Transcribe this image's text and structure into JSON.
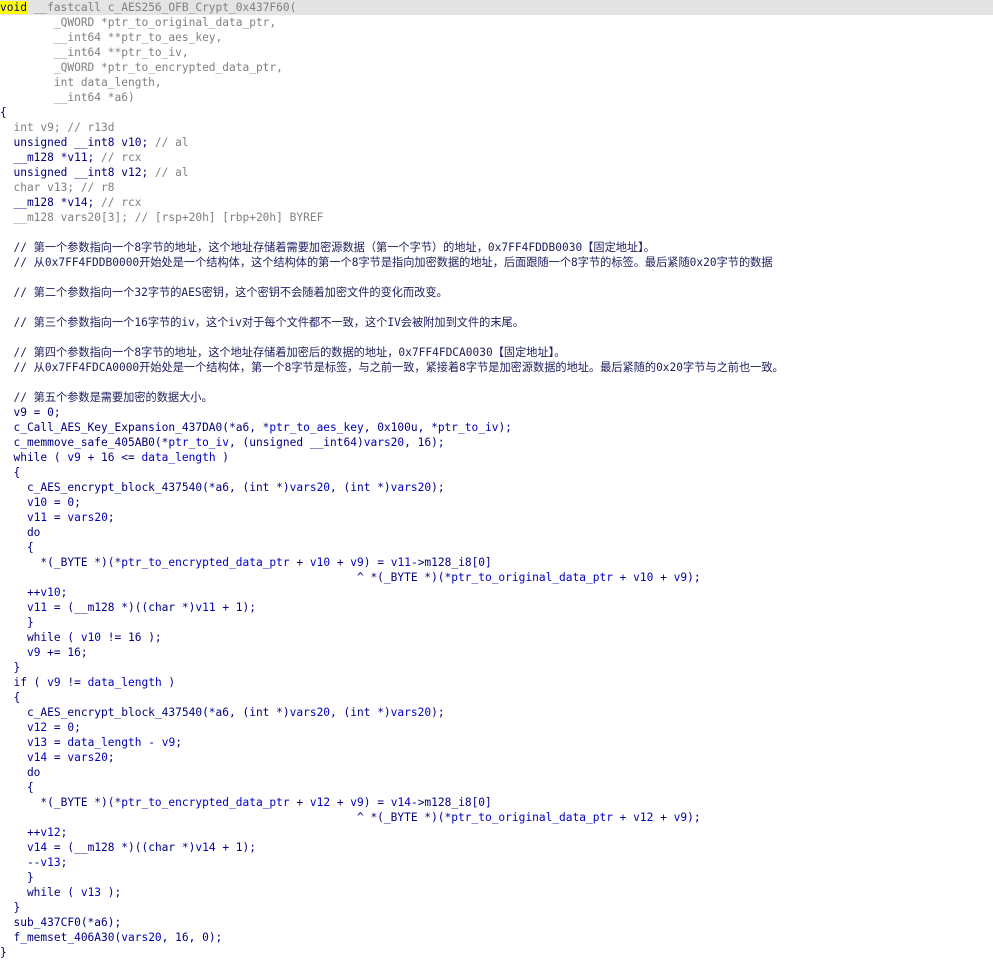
{
  "colors": {
    "background": "#ffffff",
    "highlight_line": "#e4e4e4",
    "keyword_highlight": "#ffff00",
    "text": "#000080",
    "variable": "#0000c0",
    "type_gray": "#808080",
    "comment": "#408080"
  },
  "code": {
    "lines": [
      [
        {
          "t": "void",
          "c": "kw-hl"
        },
        {
          "t": " __fastcall c_AES256_OFB_Crypt_0x437F60(",
          "c": "type"
        }
      ],
      [
        {
          "t": "        _QWORD *ptr_to_original_data_ptr,",
          "c": "type"
        }
      ],
      [
        {
          "t": "        __int64 **ptr_to_aes_key,",
          "c": "type"
        }
      ],
      [
        {
          "t": "        __int64 **ptr_to_iv,",
          "c": "type"
        }
      ],
      [
        {
          "t": "        _QWORD *ptr_to_encrypted_data_ptr,",
          "c": "type"
        }
      ],
      [
        {
          "t": "        int data_length,",
          "c": "type"
        }
      ],
      [
        {
          "t": "        __int64 *a6)",
          "c": "type"
        }
      ],
      [
        {
          "t": "{",
          "c": "plain"
        }
      ],
      [
        {
          "t": "  int v9; // r13d",
          "c": "type"
        }
      ],
      [
        {
          "t": "  unsigned __int8 v10; ",
          "c": "plain"
        },
        {
          "t": "// al",
          "c": "type"
        }
      ],
      [
        {
          "t": "  __m128 *v11; ",
          "c": "plain"
        },
        {
          "t": "// rcx",
          "c": "type"
        }
      ],
      [
        {
          "t": "  unsigned __int8 v12; ",
          "c": "plain"
        },
        {
          "t": "// al",
          "c": "type"
        }
      ],
      [
        {
          "t": "  char v13; // r8",
          "c": "type"
        }
      ],
      [
        {
          "t": "  __m128 *v14; ",
          "c": "plain"
        },
        {
          "t": "// rcx",
          "c": "type"
        }
      ],
      [
        {
          "t": "  __m128 vars20[3]; // [rsp+20h] [rbp+20h] BYREF",
          "c": "type"
        }
      ],
      [
        {
          "t": "",
          "c": "plain"
        }
      ],
      [
        {
          "t": "  // 第一个参数指向一个8字节的地址，这个地址存储着需要加密源数据（第一个字节）的地址，0x7FF4FDDB0030【固定地址】。",
          "c": "cmt-cn"
        }
      ],
      [
        {
          "t": "  // 从0x7FF4FDDB0000开始处是一个结构体，这个结构体的第一个8字节是指向加密数据的地址，后面跟随一个8字节的标签。最后紧随0x20字节的数据",
          "c": "cmt-cn"
        }
      ],
      [
        {
          "t": "",
          "c": "plain"
        }
      ],
      [
        {
          "t": "  // 第二个参数指向一个32字节的AES密钥，这个密钥不会随着加密文件的变化而改变。",
          "c": "cmt-cn"
        }
      ],
      [
        {
          "t": "",
          "c": "plain"
        }
      ],
      [
        {
          "t": "  // 第三个参数指向一个16字节的iv，这个iv对于每个文件都不一致，这个IV会被附加到文件的末尾。",
          "c": "cmt-cn"
        }
      ],
      [
        {
          "t": "",
          "c": "plain"
        }
      ],
      [
        {
          "t": "  // 第四个参数指向一个8字节的地址，这个地址存储着加密后的数据的地址，0x7FF4FDCA0030【固定地址】。",
          "c": "cmt-cn"
        }
      ],
      [
        {
          "t": "  // 从0x7FF4FDCA0000开始处是一个结构体，第一个8字节是标签，与之前一致，紧接着8字节是加密源数据的地址。最后紧随的0x20字节与之前也一致。",
          "c": "cmt-cn"
        }
      ],
      [
        {
          "t": "",
          "c": "plain"
        }
      ],
      [
        {
          "t": "  // 第五个参数是需要加密的数据大小。",
          "c": "cmt-cn"
        }
      ],
      [
        {
          "t": "  v9 = 0;",
          "c": "plain"
        }
      ],
      [
        {
          "t": "  c_Call_AES_Key_Expansion_437DA0(*a6, *",
          "c": "plain"
        },
        {
          "t": "ptr_to_aes_key",
          "c": "var"
        },
        {
          "t": ", 0x100u, *",
          "c": "plain"
        },
        {
          "t": "ptr_to_iv",
          "c": "var"
        },
        {
          "t": ");",
          "c": "plain"
        }
      ],
      [
        {
          "t": "  c_memmove_safe_405AB0(*",
          "c": "plain"
        },
        {
          "t": "ptr_to_iv",
          "c": "var"
        },
        {
          "t": ", (unsigned __int64)",
          "c": "plain"
        },
        {
          "t": "vars20",
          "c": "var"
        },
        {
          "t": ", 16);",
          "c": "plain"
        }
      ],
      [
        {
          "t": "  while ( ",
          "c": "plain"
        },
        {
          "t": "v9",
          "c": "var"
        },
        {
          "t": " + 16 <= ",
          "c": "plain"
        },
        {
          "t": "data_length",
          "c": "var"
        },
        {
          "t": " )",
          "c": "plain"
        }
      ],
      [
        {
          "t": "  {",
          "c": "plain"
        }
      ],
      [
        {
          "t": "    c_AES_encrypt_block_437540(*a6, (int *)",
          "c": "plain"
        },
        {
          "t": "vars20",
          "c": "var"
        },
        {
          "t": ", (int *)",
          "c": "plain"
        },
        {
          "t": "vars20",
          "c": "var"
        },
        {
          "t": ");",
          "c": "plain"
        }
      ],
      [
        {
          "t": "    ",
          "c": "plain"
        },
        {
          "t": "v10",
          "c": "var"
        },
        {
          "t": " = 0;",
          "c": "plain"
        }
      ],
      [
        {
          "t": "    ",
          "c": "plain"
        },
        {
          "t": "v11",
          "c": "var"
        },
        {
          "t": " = ",
          "c": "plain"
        },
        {
          "t": "vars20",
          "c": "var"
        },
        {
          "t": ";",
          "c": "plain"
        }
      ],
      [
        {
          "t": "    do",
          "c": "plain"
        }
      ],
      [
        {
          "t": "    {",
          "c": "plain"
        }
      ],
      [
        {
          "t": "      *(_BYTE *)(*",
          "c": "plain"
        },
        {
          "t": "ptr_to_encrypted_data_ptr",
          "c": "var"
        },
        {
          "t": " + ",
          "c": "plain"
        },
        {
          "t": "v10",
          "c": "var"
        },
        {
          "t": " + ",
          "c": "plain"
        },
        {
          "t": "v9",
          "c": "var"
        },
        {
          "t": ") = ",
          "c": "plain"
        },
        {
          "t": "v11",
          "c": "var"
        },
        {
          "t": "->m128_i8[0]",
          "c": "plain"
        }
      ],
      [
        {
          "t": "                                                     ^ *(_BYTE *)(*",
          "c": "plain"
        },
        {
          "t": "ptr_to_original_data_ptr",
          "c": "var"
        },
        {
          "t": " + ",
          "c": "plain"
        },
        {
          "t": "v10",
          "c": "var"
        },
        {
          "t": " + ",
          "c": "plain"
        },
        {
          "t": "v9",
          "c": "var"
        },
        {
          "t": ");",
          "c": "plain"
        }
      ],
      [
        {
          "t": "    ++",
          "c": "plain"
        },
        {
          "t": "v10",
          "c": "var"
        },
        {
          "t": ";",
          "c": "plain"
        }
      ],
      [
        {
          "t": "    ",
          "c": "plain"
        },
        {
          "t": "v11",
          "c": "var"
        },
        {
          "t": " = (__m128 *)((char *)",
          "c": "plain"
        },
        {
          "t": "v11",
          "c": "var"
        },
        {
          "t": " + 1);",
          "c": "plain"
        }
      ],
      [
        {
          "t": "    }",
          "c": "plain"
        }
      ],
      [
        {
          "t": "    while ( ",
          "c": "plain"
        },
        {
          "t": "v10",
          "c": "var"
        },
        {
          "t": " != 16 );",
          "c": "plain"
        }
      ],
      [
        {
          "t": "    ",
          "c": "plain"
        },
        {
          "t": "v9",
          "c": "var"
        },
        {
          "t": " += 16;",
          "c": "plain"
        }
      ],
      [
        {
          "t": "  }",
          "c": "plain"
        }
      ],
      [
        {
          "t": "  if ( ",
          "c": "plain"
        },
        {
          "t": "v9",
          "c": "var"
        },
        {
          "t": " != ",
          "c": "plain"
        },
        {
          "t": "data_length",
          "c": "var"
        },
        {
          "t": " )",
          "c": "plain"
        }
      ],
      [
        {
          "t": "  {",
          "c": "plain"
        }
      ],
      [
        {
          "t": "    c_AES_encrypt_block_437540(*a6, (int *)",
          "c": "plain"
        },
        {
          "t": "vars20",
          "c": "var"
        },
        {
          "t": ", (int *)",
          "c": "plain"
        },
        {
          "t": "vars20",
          "c": "var"
        },
        {
          "t": ");",
          "c": "plain"
        }
      ],
      [
        {
          "t": "    ",
          "c": "plain"
        },
        {
          "t": "v12",
          "c": "var"
        },
        {
          "t": " = 0;",
          "c": "plain"
        }
      ],
      [
        {
          "t": "    ",
          "c": "plain"
        },
        {
          "t": "v13",
          "c": "var"
        },
        {
          "t": " = ",
          "c": "plain"
        },
        {
          "t": "data_length",
          "c": "var"
        },
        {
          "t": " - ",
          "c": "plain"
        },
        {
          "t": "v9",
          "c": "var"
        },
        {
          "t": ";",
          "c": "plain"
        }
      ],
      [
        {
          "t": "    ",
          "c": "plain"
        },
        {
          "t": "v14",
          "c": "var"
        },
        {
          "t": " = ",
          "c": "plain"
        },
        {
          "t": "vars20",
          "c": "var"
        },
        {
          "t": ";",
          "c": "plain"
        }
      ],
      [
        {
          "t": "    do",
          "c": "plain"
        }
      ],
      [
        {
          "t": "    {",
          "c": "plain"
        }
      ],
      [
        {
          "t": "      *(_BYTE *)(*",
          "c": "plain"
        },
        {
          "t": "ptr_to_encrypted_data_ptr",
          "c": "var"
        },
        {
          "t": " + ",
          "c": "plain"
        },
        {
          "t": "v12",
          "c": "var"
        },
        {
          "t": " + ",
          "c": "plain"
        },
        {
          "t": "v9",
          "c": "var"
        },
        {
          "t": ") = ",
          "c": "plain"
        },
        {
          "t": "v14",
          "c": "var"
        },
        {
          "t": "->m128_i8[0]",
          "c": "plain"
        }
      ],
      [
        {
          "t": "                                                     ^ *(_BYTE *)(*",
          "c": "plain"
        },
        {
          "t": "ptr_to_original_data_ptr",
          "c": "var"
        },
        {
          "t": " + ",
          "c": "plain"
        },
        {
          "t": "v12",
          "c": "var"
        },
        {
          "t": " + ",
          "c": "plain"
        },
        {
          "t": "v9",
          "c": "var"
        },
        {
          "t": ");",
          "c": "plain"
        }
      ],
      [
        {
          "t": "    ++",
          "c": "plain"
        },
        {
          "t": "v12",
          "c": "var"
        },
        {
          "t": ";",
          "c": "plain"
        }
      ],
      [
        {
          "t": "    ",
          "c": "plain"
        },
        {
          "t": "v14",
          "c": "var"
        },
        {
          "t": " = (__m128 *)((char *)",
          "c": "plain"
        },
        {
          "t": "v14",
          "c": "var"
        },
        {
          "t": " + 1);",
          "c": "plain"
        }
      ],
      [
        {
          "t": "    --",
          "c": "plain"
        },
        {
          "t": "v13",
          "c": "var"
        },
        {
          "t": ";",
          "c": "plain"
        }
      ],
      [
        {
          "t": "    }",
          "c": "plain"
        }
      ],
      [
        {
          "t": "    while ( ",
          "c": "plain"
        },
        {
          "t": "v13",
          "c": "var"
        },
        {
          "t": " );",
          "c": "plain"
        }
      ],
      [
        {
          "t": "  }",
          "c": "plain"
        }
      ],
      [
        {
          "t": "  sub_437CF0(*a6);",
          "c": "plain"
        }
      ],
      [
        {
          "t": "  f_memset_406A30(",
          "c": "plain"
        },
        {
          "t": "vars20",
          "c": "var"
        },
        {
          "t": ", 16, 0);",
          "c": "plain"
        }
      ],
      [
        {
          "t": "}",
          "c": "plain"
        }
      ]
    ]
  }
}
